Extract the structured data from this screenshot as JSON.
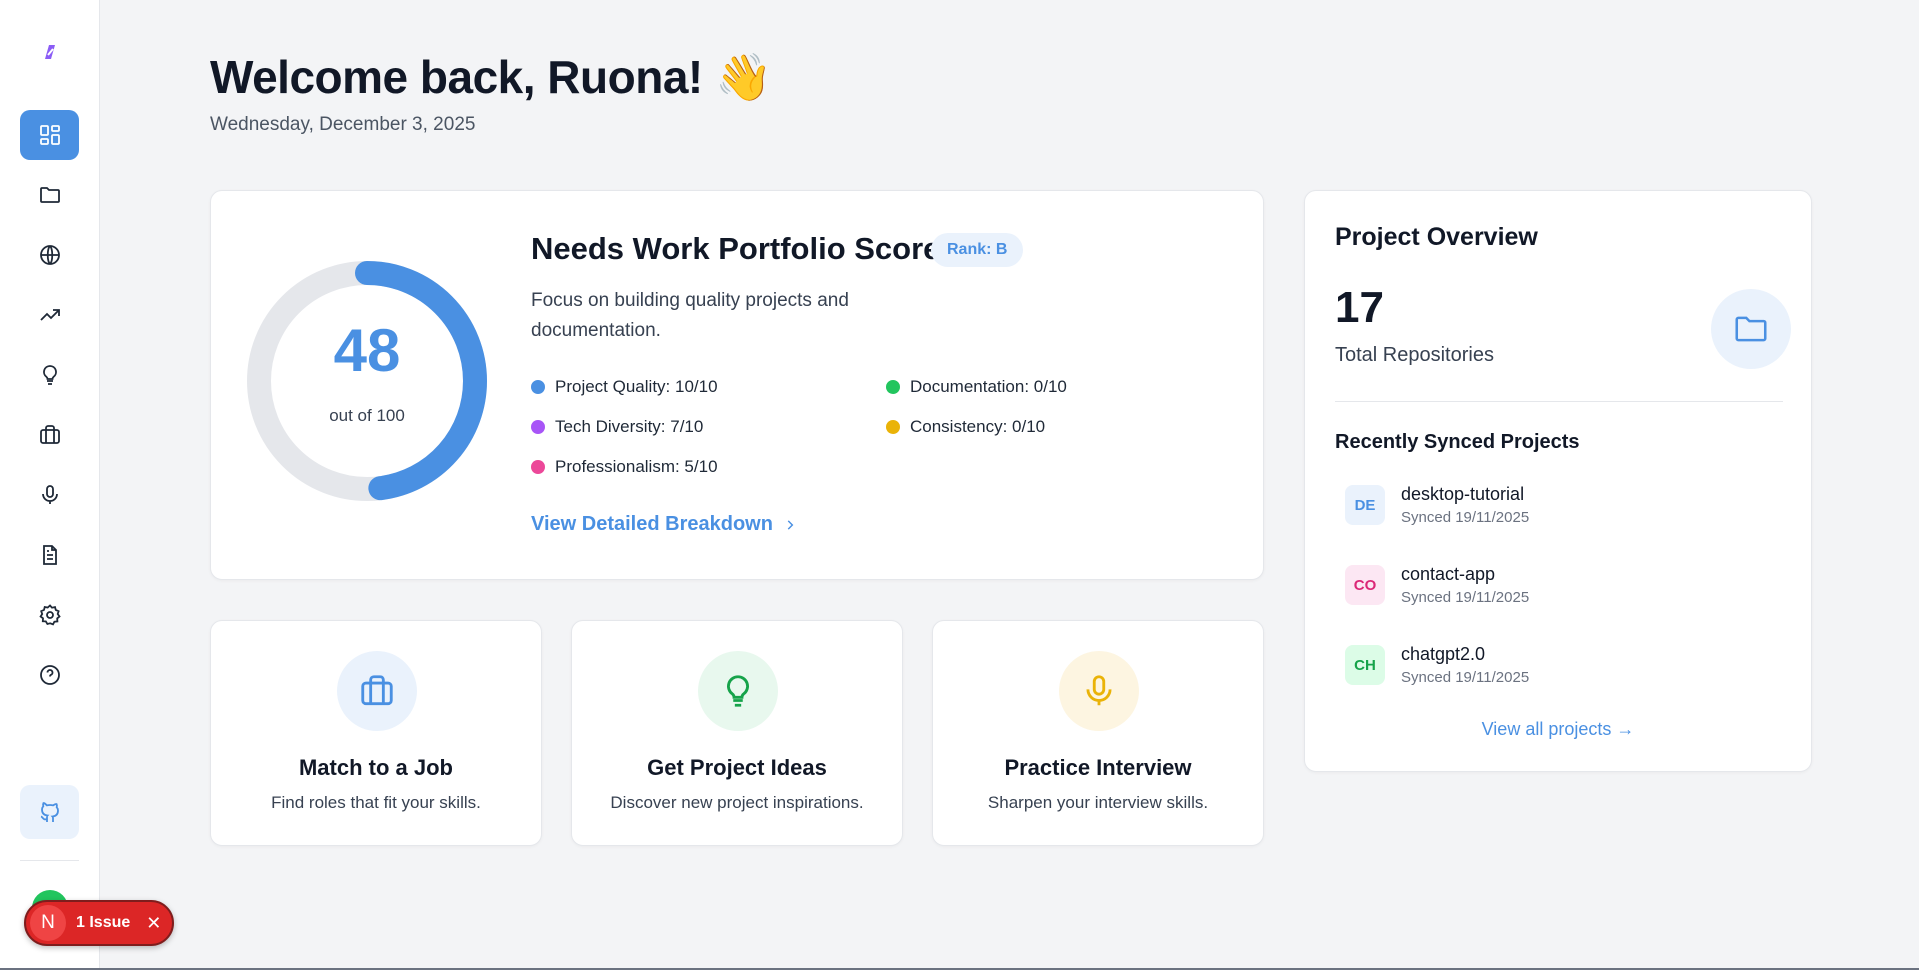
{
  "header": {
    "welcome": "Welcome back, Ruona! 👋",
    "date": "Wednesday, December 3, 2025"
  },
  "sidebar": {
    "items": [
      {
        "icon": "dashboard-icon",
        "active": true
      },
      {
        "icon": "folder-icon"
      },
      {
        "icon": "globe-icon"
      },
      {
        "icon": "trending-up-icon"
      },
      {
        "icon": "lightbulb-icon"
      },
      {
        "icon": "briefcase-icon"
      },
      {
        "icon": "microphone-icon"
      },
      {
        "icon": "document-icon"
      },
      {
        "icon": "gear-icon"
      },
      {
        "icon": "help-icon"
      }
    ],
    "github_icon": "github-icon"
  },
  "issue": {
    "initial": "N",
    "label": "1 Issue",
    "close": "✕"
  },
  "score_card": {
    "score": "48",
    "score_value": 48,
    "score_max": 100,
    "out_of": "out of 100",
    "title": "Needs Work Portfolio Score!",
    "rank": "Rank: B",
    "description": "Focus on building quality projects and documentation.",
    "metrics": [
      {
        "label": "Project Quality: 10/10",
        "color": "#4a90e2"
      },
      {
        "label": "Documentation: 0/10",
        "color": "#22c55e"
      },
      {
        "label": "Tech Diversity: 7/10",
        "color": "#a855f7"
      },
      {
        "label": "Consistency: 0/10",
        "color": "#eab308"
      },
      {
        "label": "Professionalism: 5/10",
        "color": "#ec4899"
      }
    ],
    "breakdown_link": "View Detailed Breakdown"
  },
  "actions": [
    {
      "title": "Match to a Job",
      "subtitle": "Find roles that fit your skills.",
      "icon": "briefcase-icon",
      "bg": "#eaf2fc",
      "fg": "#4a90e2"
    },
    {
      "title": "Get Project Ideas",
      "subtitle": "Discover new project inspirations.",
      "icon": "lightbulb-icon",
      "bg": "#e8f8ee",
      "fg": "#16a34a"
    },
    {
      "title": "Practice Interview",
      "subtitle": "Sharpen your interview skills.",
      "icon": "microphone-icon",
      "bg": "#fdf5e1",
      "fg": "#eab308"
    }
  ],
  "overview": {
    "title": "Project Overview",
    "count": "17",
    "count_label": "Total Repositories",
    "recent_title": "Recently Synced Projects",
    "projects": [
      {
        "badge": "DE",
        "name": "desktop-tutorial",
        "synced": "Synced 19/11/2025",
        "bg": "#eaf2fc",
        "fg": "#4a90e2"
      },
      {
        "badge": "CO",
        "name": "contact-app",
        "synced": "Synced 19/11/2025",
        "bg": "#fce7f3",
        "fg": "#db2777"
      },
      {
        "badge": "CH",
        "name": "chatgpt2.0",
        "synced": "Synced 19/11/2025",
        "bg": "#dcfce7",
        "fg": "#16a34a"
      }
    ],
    "view_all": "View all projects →"
  }
}
